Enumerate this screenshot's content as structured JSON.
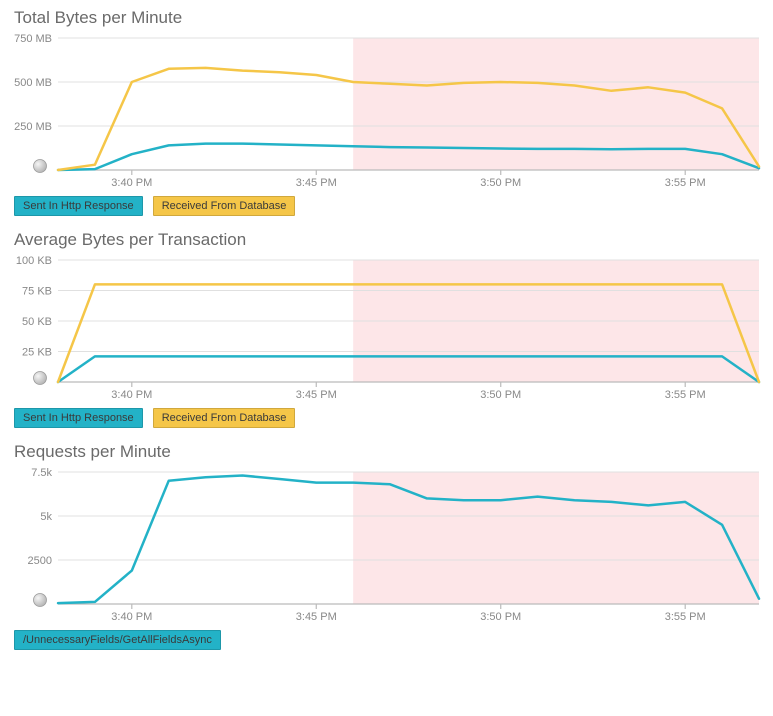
{
  "colors": {
    "cyan": "#23b2c7",
    "gold": "#f5c648",
    "shade": "#fde6e8"
  },
  "x_labels": [
    "3:40 PM",
    "3:45 PM",
    "3:50 PM",
    "3:55 PM"
  ],
  "shade_start_label": "3:46 PM",
  "chart_data": [
    {
      "id": "total_bytes",
      "type": "line",
      "title": "Total Bytes per Minute",
      "xlabel": "",
      "ylabel": "",
      "ylim": [
        0,
        750
      ],
      "y_unit": "MB",
      "y_ticks": [
        250,
        500,
        750
      ],
      "y_tick_labels": [
        "250 MB",
        "500 MB",
        "750 MB"
      ],
      "x": [
        0,
        1,
        2,
        3,
        4,
        5,
        6,
        7,
        8,
        9,
        10,
        11,
        12,
        13,
        14,
        15,
        16,
        17,
        18,
        19
      ],
      "series": [
        {
          "name": "Sent In Http Response",
          "color_key": "cyan",
          "values": [
            0,
            5,
            90,
            140,
            150,
            150,
            145,
            140,
            135,
            130,
            128,
            125,
            122,
            120,
            120,
            118,
            120,
            120,
            90,
            10
          ]
        },
        {
          "name": "Received From Database",
          "color_key": "gold",
          "values": [
            0,
            30,
            500,
            575,
            580,
            565,
            555,
            540,
            500,
            490,
            480,
            495,
            500,
            495,
            480,
            450,
            470,
            440,
            350,
            20
          ]
        }
      ],
      "legend": [
        {
          "label": "Sent In Http Response",
          "color_key": "cyan"
        },
        {
          "label": "Received From Database",
          "color_key": "gold"
        }
      ]
    },
    {
      "id": "avg_bytes",
      "type": "line",
      "title": "Average Bytes per Transaction",
      "xlabel": "",
      "ylabel": "",
      "ylim": [
        0,
        100
      ],
      "y_unit": "KB",
      "y_ticks": [
        25,
        50,
        75,
        100
      ],
      "y_tick_labels": [
        "25 KB",
        "50 KB",
        "75 KB",
        "100 KB"
      ],
      "x": [
        0,
        1,
        2,
        3,
        4,
        5,
        6,
        7,
        8,
        9,
        10,
        11,
        12,
        13,
        14,
        15,
        16,
        17,
        18,
        19
      ],
      "series": [
        {
          "name": "Sent In Http Response",
          "color_key": "cyan",
          "values": [
            0,
            21,
            21,
            21,
            21,
            21,
            21,
            21,
            21,
            21,
            21,
            21,
            21,
            21,
            21,
            21,
            21,
            21,
            21,
            0
          ]
        },
        {
          "name": "Received From Database",
          "color_key": "gold",
          "values": [
            0,
            80,
            80,
            80,
            80,
            80,
            80,
            80,
            80,
            80,
            80,
            80,
            80,
            80,
            80,
            80,
            80,
            80,
            80,
            0
          ]
        }
      ],
      "legend": [
        {
          "label": "Sent In Http Response",
          "color_key": "cyan"
        },
        {
          "label": "Received From Database",
          "color_key": "gold"
        }
      ]
    },
    {
      "id": "requests",
      "type": "line",
      "title": "Requests per Minute",
      "xlabel": "",
      "ylabel": "",
      "ylim": [
        0,
        7500
      ],
      "y_unit": "",
      "y_ticks": [
        2500,
        5000,
        7500
      ],
      "y_tick_labels": [
        "2500",
        "5k",
        "7.5k"
      ],
      "x": [
        0,
        1,
        2,
        3,
        4,
        5,
        6,
        7,
        8,
        9,
        10,
        11,
        12,
        13,
        14,
        15,
        16,
        17,
        18,
        19
      ],
      "series": [
        {
          "name": "/UnnecessaryFields/GetAllFieldsAsync",
          "color_key": "cyan",
          "values": [
            50,
            120,
            1900,
            7000,
            7200,
            7300,
            7100,
            6900,
            6900,
            6800,
            6000,
            5900,
            5900,
            6100,
            5900,
            5800,
            5600,
            5800,
            4500,
            300
          ]
        }
      ],
      "legend": [
        {
          "label": "/UnnecessaryFields/GetAllFieldsAsync",
          "color_key": "cyan"
        }
      ]
    }
  ]
}
